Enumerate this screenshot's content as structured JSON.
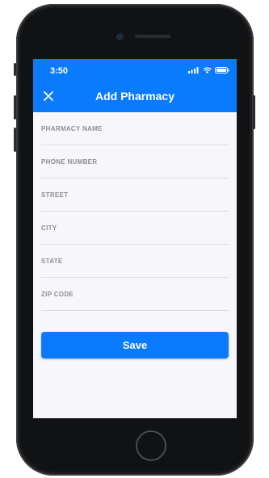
{
  "status_bar": {
    "time": "3:50",
    "icons": [
      "signal-icon",
      "wifi-icon",
      "battery-icon"
    ]
  },
  "header": {
    "close_icon": "close-icon",
    "title": "Add Pharmacy"
  },
  "form": {
    "fields": [
      {
        "placeholder": "PHARMACY NAME",
        "value": ""
      },
      {
        "placeholder": "PHONE NUMBER",
        "value": ""
      },
      {
        "placeholder": "STREET",
        "value": ""
      },
      {
        "placeholder": "CITY",
        "value": ""
      },
      {
        "placeholder": "STATE",
        "value": ""
      },
      {
        "placeholder": "ZIP CODE",
        "value": ""
      }
    ],
    "save_label": "Save"
  },
  "colors": {
    "accent": "#0a7afe",
    "background": "#f7f6fb",
    "placeholder": "#8e8e93",
    "divider": "#dcdce2"
  }
}
